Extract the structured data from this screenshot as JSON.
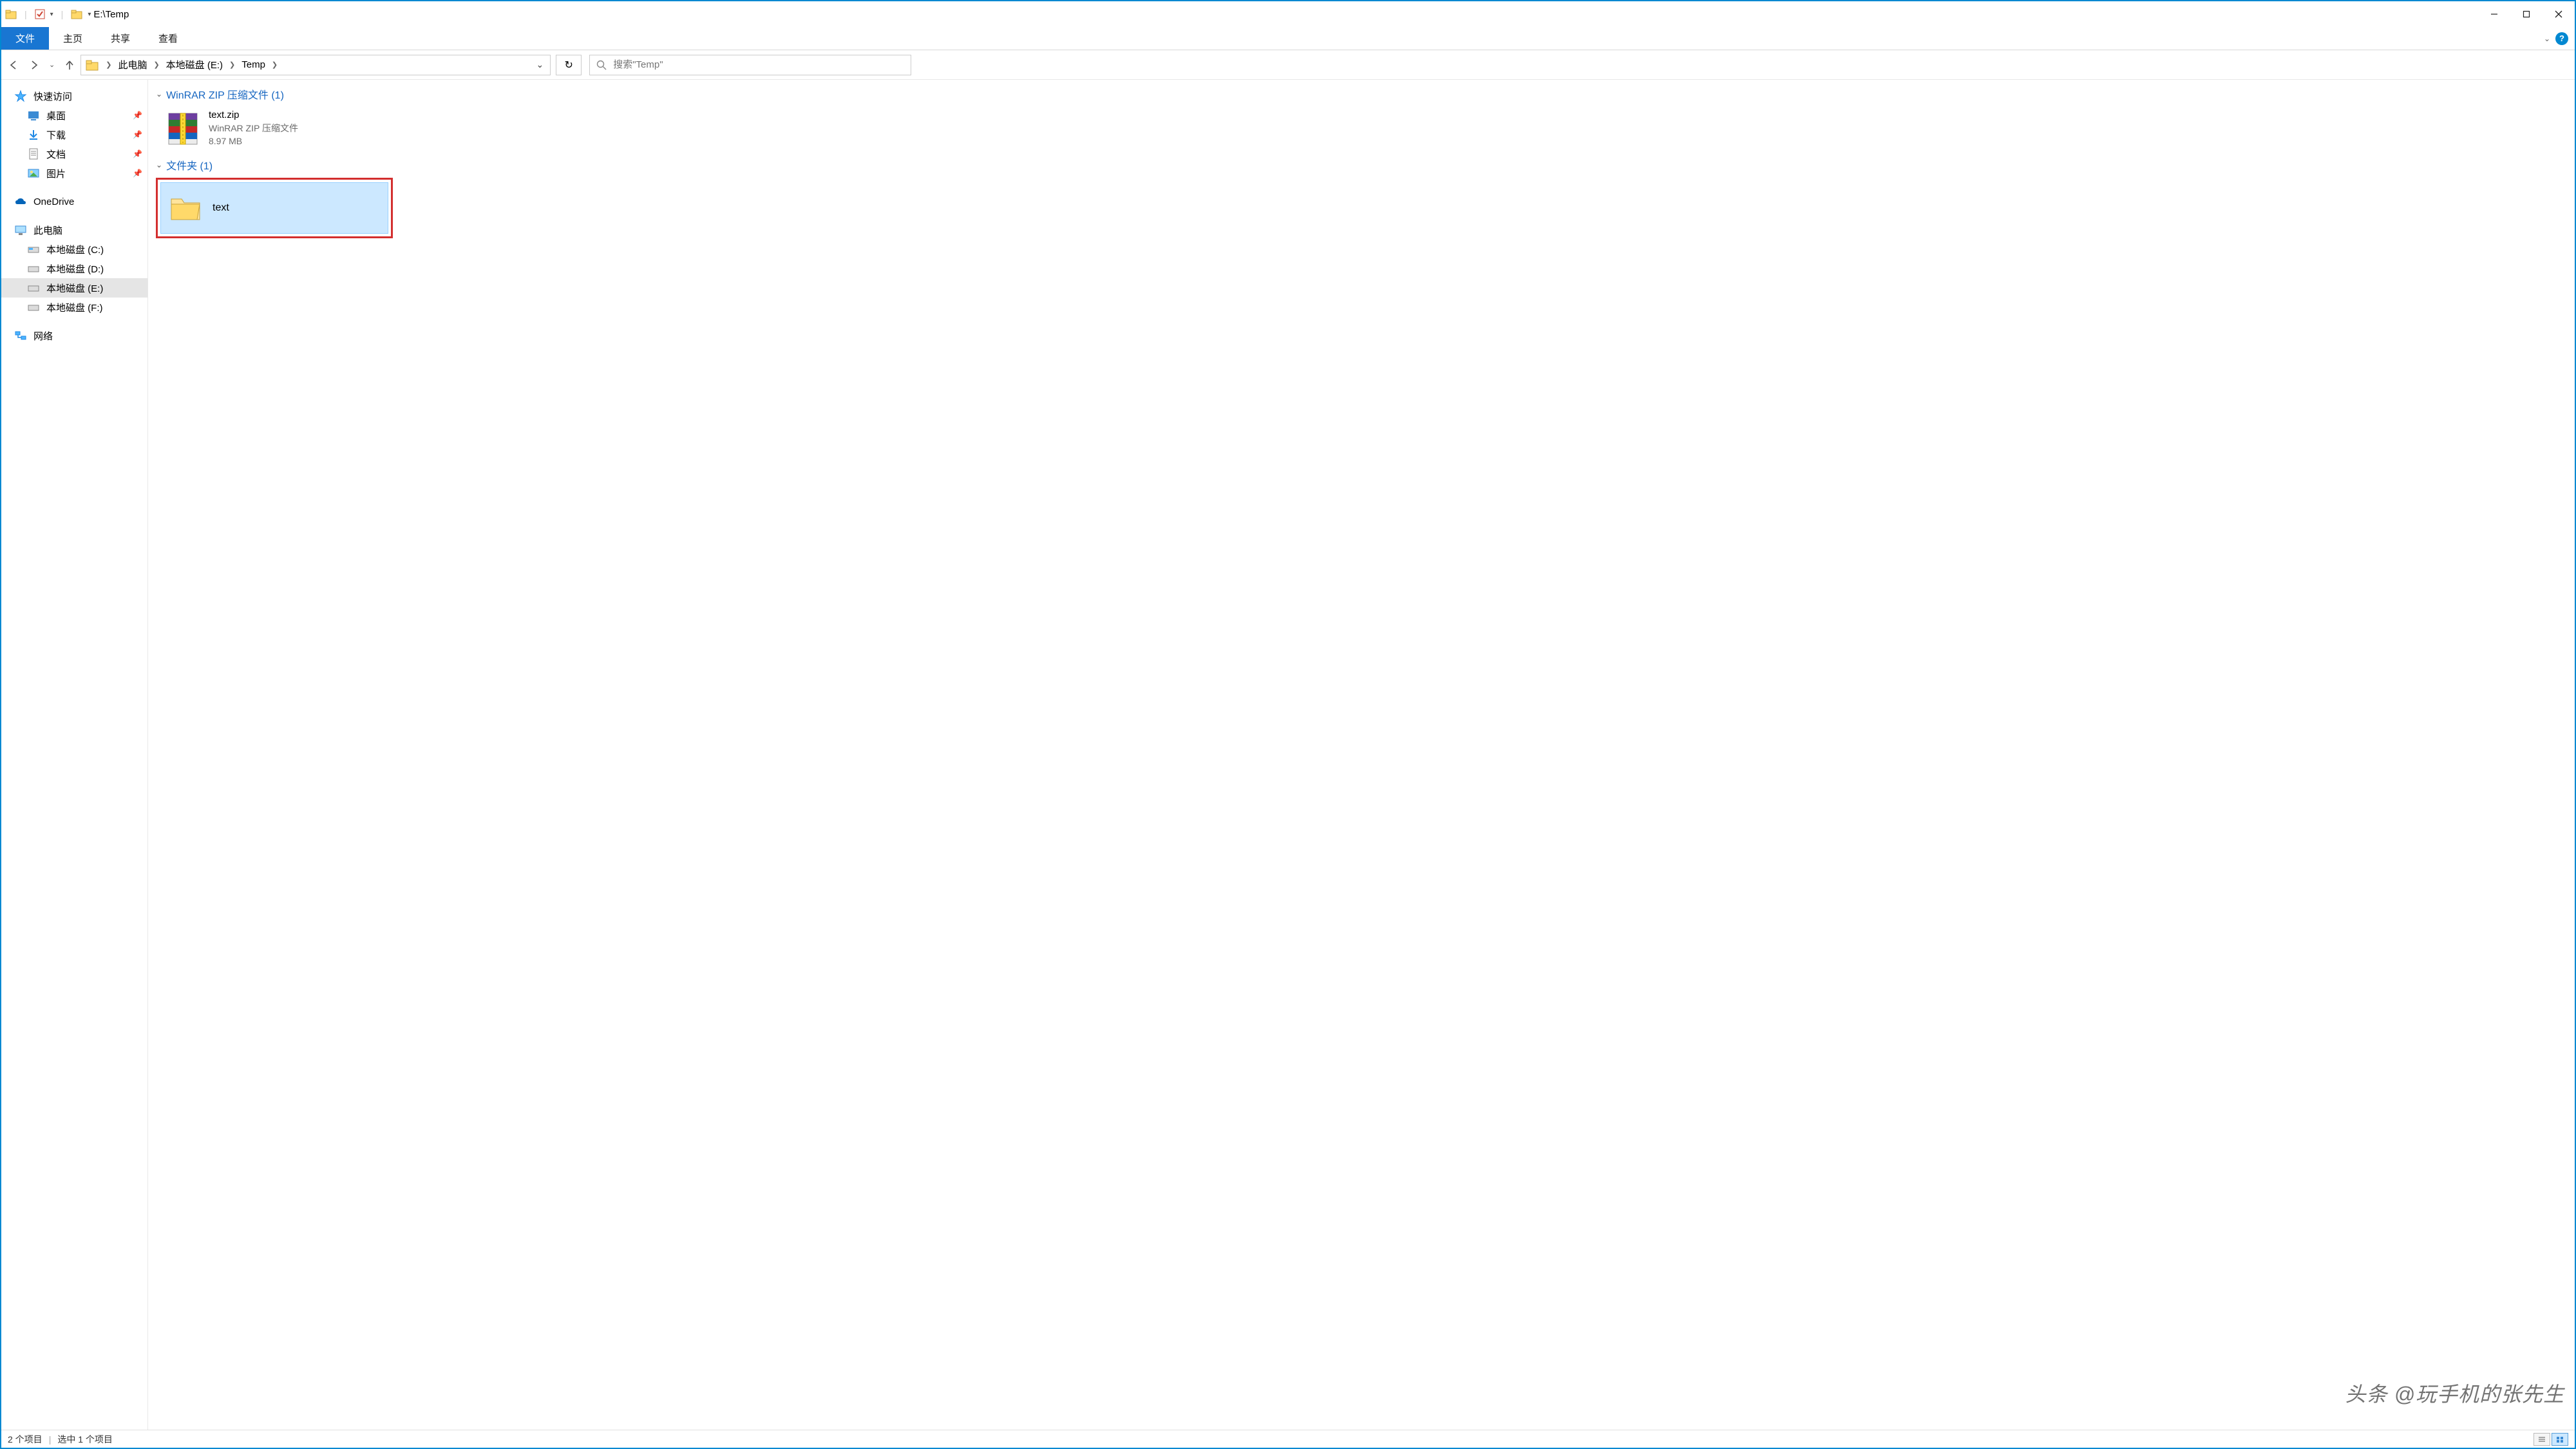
{
  "window": {
    "title": "E:\\Temp"
  },
  "ribbon": {
    "file": "文件",
    "tabs": [
      "主页",
      "共享",
      "查看"
    ],
    "help_tooltip": "?"
  },
  "nav": {
    "breadcrumbs": [
      "此电脑",
      "本地磁盘 (E:)",
      "Temp"
    ]
  },
  "search": {
    "placeholder": "搜索\"Temp\""
  },
  "sidebar": {
    "quick_access": "快速访问",
    "quick_items": [
      {
        "label": "桌面",
        "icon": "desktop"
      },
      {
        "label": "下载",
        "icon": "download"
      },
      {
        "label": "文档",
        "icon": "document"
      },
      {
        "label": "图片",
        "icon": "pictures"
      }
    ],
    "onedrive": "OneDrive",
    "this_pc": "此电脑",
    "drives": [
      {
        "label": "本地磁盘 (C:)",
        "selected": false,
        "icon": "drive-c"
      },
      {
        "label": "本地磁盘 (D:)",
        "selected": false,
        "icon": "drive"
      },
      {
        "label": "本地磁盘 (E:)",
        "selected": true,
        "icon": "drive"
      },
      {
        "label": "本地磁盘 (F:)",
        "selected": false,
        "icon": "drive"
      }
    ],
    "network": "网络"
  },
  "groups": [
    {
      "title": "WinRAR ZIP 压缩文件 (1)",
      "type": "files",
      "items": [
        {
          "name": "text.zip",
          "subtitle": "WinRAR ZIP 压缩文件",
          "size": "8.97 MB"
        }
      ]
    },
    {
      "title": "文件夹 (1)",
      "type": "folders",
      "items": [
        {
          "name": "text",
          "selected": true,
          "highlighted": true
        }
      ]
    }
  ],
  "status": {
    "count": "2 个项目",
    "selection": "选中 1 个项目"
  },
  "watermark": "头条 @玩手机的张先生"
}
